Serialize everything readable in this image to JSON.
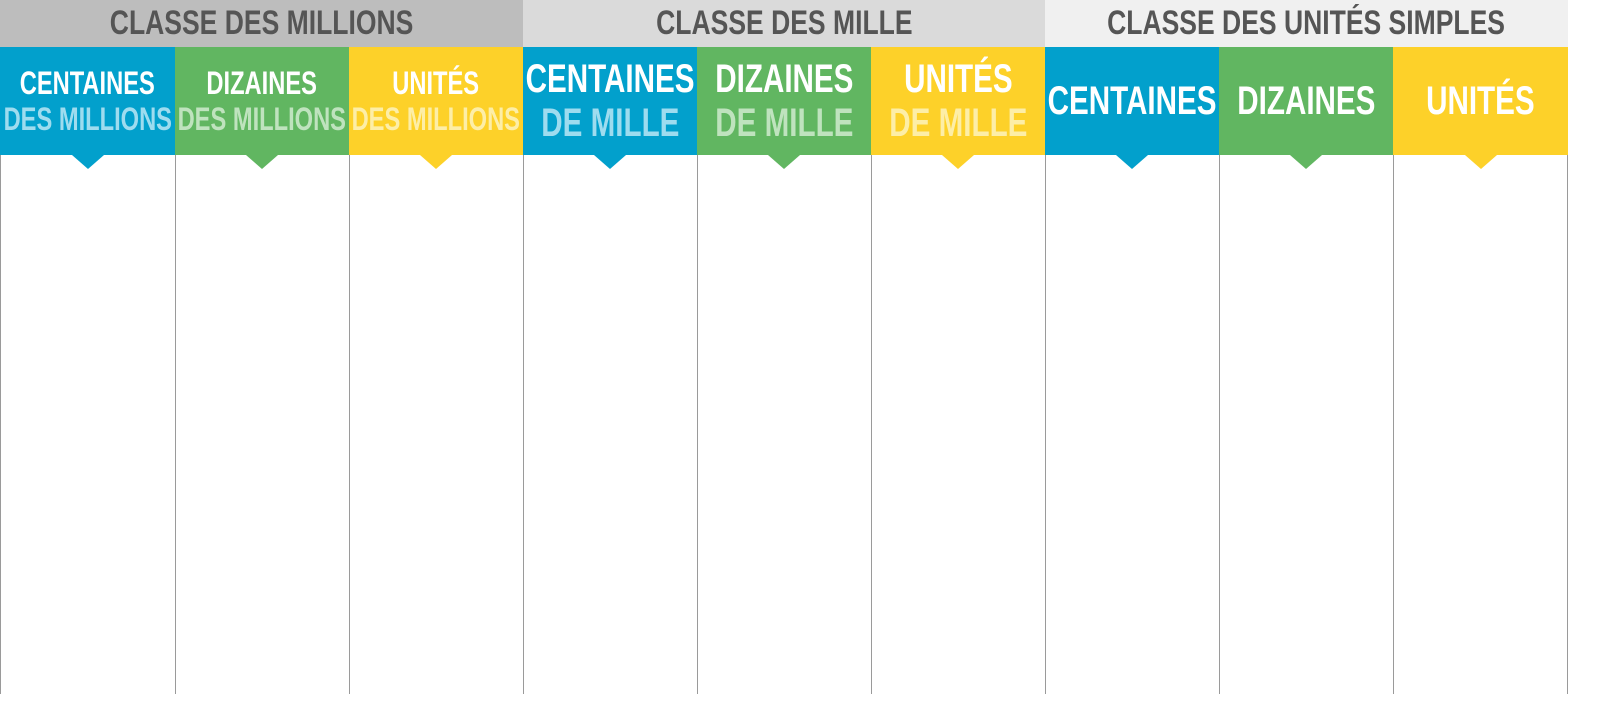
{
  "classes": [
    {
      "label": "CLASSE DES MILLIONS"
    },
    {
      "label": "CLASSE DES MILLE"
    },
    {
      "label": "CLASSE DES UNITÉS SIMPLES"
    }
  ],
  "columns": [
    {
      "line1": "CENTAINES",
      "line2": "DES MILLIONS",
      "color": "#02a0cc"
    },
    {
      "line1": "DIZAINES",
      "line2": "DES MILLIONS",
      "color": "#61b661"
    },
    {
      "line1": "UNITÉS",
      "line2": "DES MILLIONS",
      "color": "#fdd129"
    },
    {
      "line1": "CENTAINES",
      "line2": "DE MILLE",
      "color": "#02a0cc"
    },
    {
      "line1": "DIZAINES",
      "line2": "DE MILLE",
      "color": "#61b661"
    },
    {
      "line1": "UNITÉS",
      "line2": "DE MILLE",
      "color": "#fdd129"
    },
    {
      "line1": "CENTAINES",
      "color": "#02a0cc"
    },
    {
      "line1": "DIZAINES",
      "color": "#61b661"
    },
    {
      "line1": "UNITÉS",
      "color": "#fdd129"
    }
  ]
}
